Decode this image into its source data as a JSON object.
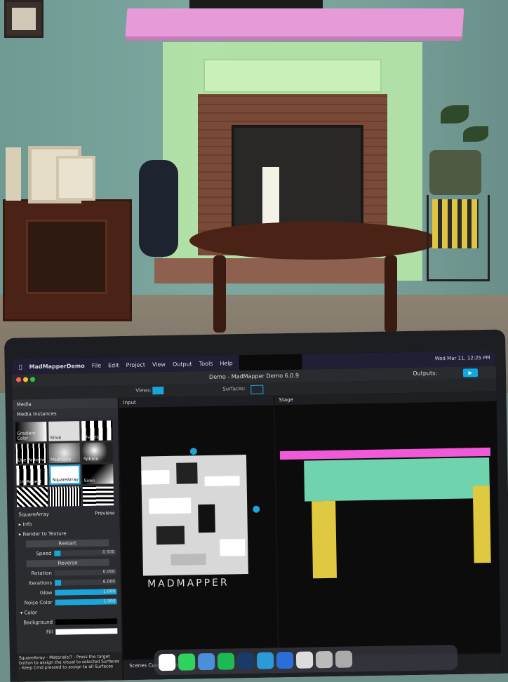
{
  "app": {
    "menu": [
      "MadMapperDemo",
      "File",
      "Edit",
      "Project",
      "View",
      "Output",
      "Tools",
      "Help"
    ],
    "clock": "Wed Mar 11, 12:25 PM",
    "window_title": "Demo - MadMapper Demo 6.0.9",
    "outputs_label": "Outputs:",
    "views_label": "Views:",
    "surfaces_label": "Surfaces:"
  },
  "left_panel": {
    "tab_media": "Media",
    "section_title": "Media Instances",
    "thumbnails": [
      "Gradient Color",
      "Strob",
      "Shapes",
      "Line Patterns",
      "MadNoise",
      "Sphere",
      "LineRepeat",
      "SquareArray",
      "Siren",
      "",
      "",
      ""
    ],
    "selected_name": "SquareArray",
    "preview_label": "Preview:",
    "info_label": "Info",
    "render_label": "Render to Texture",
    "restart_label": "Restart",
    "reverse_label": "Reverse",
    "params": [
      {
        "label": "Speed",
        "value": "0.500",
        "fill": 0.1
      },
      {
        "label": "Rotation",
        "value": "0.000",
        "fill": 0.0
      },
      {
        "label": "Iterations",
        "value": "6.000",
        "fill": 0.1
      },
      {
        "label": "Glow",
        "value": "1.000",
        "fill": 1.0
      },
      {
        "label": "Noise Color",
        "value": "1.000",
        "fill": 1.0
      }
    ],
    "color_section": "Color",
    "background_label": "Background",
    "fill_label": "Fill",
    "hint": "SquareArray - Materials/? - Press the target button to assign the visual to selected Surfaces - Keep Cmd pressed to assign to all Surfaces"
  },
  "input_panel": {
    "title": "Input",
    "logo_text": "MADMAPPER"
  },
  "stage_panel": {
    "title": "Stage"
  },
  "bottom": {
    "tabs_label": "Scenes Cues Timelines"
  }
}
